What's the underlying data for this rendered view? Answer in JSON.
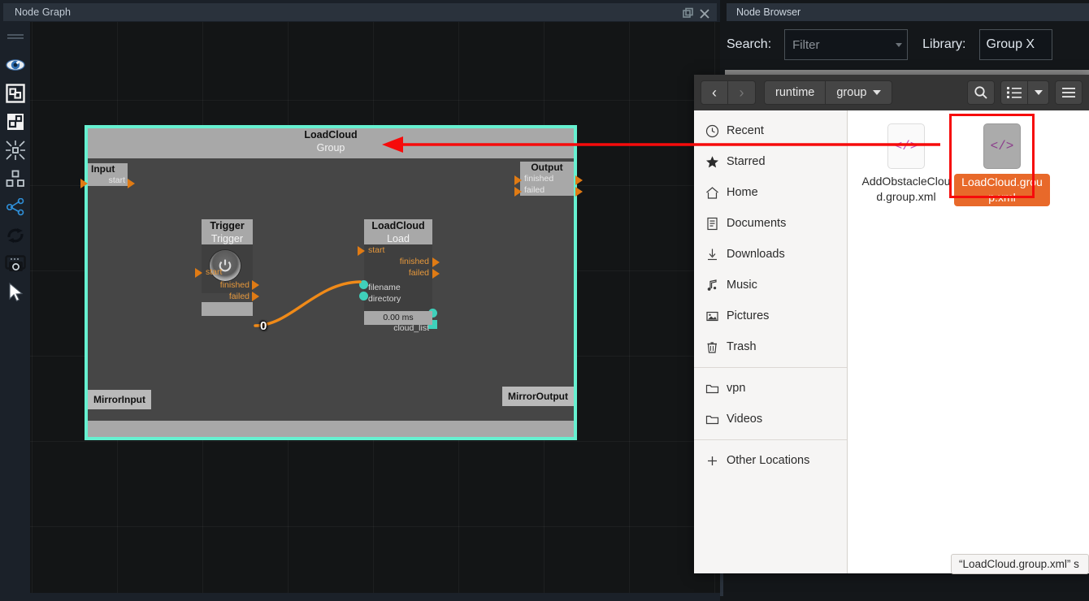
{
  "node_graph": {
    "title": "Node Graph",
    "window_buttons": [
      {
        "name": "restore-icon",
        "label": "❐"
      },
      {
        "name": "close-icon",
        "label": "✕"
      }
    ],
    "toolbar": [
      {
        "name": "grip-handle",
        "label": ""
      },
      {
        "name": "eye-icon",
        "label": ""
      },
      {
        "name": "group-icon",
        "label": ""
      },
      {
        "name": "ungroup-icon",
        "label": ""
      },
      {
        "name": "collapse-icon",
        "label": ""
      },
      {
        "name": "layout-icon",
        "label": ""
      },
      {
        "name": "share-nodes-icon",
        "label": ""
      },
      {
        "name": "refresh-icon",
        "label": ""
      },
      {
        "name": "screenshot-icon",
        "label": ""
      },
      {
        "name": "cursor-icon",
        "label": ""
      }
    ],
    "group": {
      "name": "LoadCloud",
      "type": "Group",
      "input_node": {
        "title": "Input",
        "ports": [
          "start"
        ]
      },
      "output_node": {
        "title": "Output",
        "ports": [
          "finished",
          "failed"
        ]
      },
      "mirror_input": "MirrorInput",
      "mirror_output": "MirrorOutput",
      "nodes": [
        {
          "name": "Trigger",
          "type": "Trigger",
          "inputs": [
            "start"
          ],
          "outputs": [
            "finished",
            "failed"
          ],
          "badge": "0",
          "has_power_button": true
        },
        {
          "name": "LoadCloud",
          "type": "Load",
          "inputs": [
            "start"
          ],
          "outputs": [
            "finished",
            "failed"
          ],
          "data_inputs": [
            "filename",
            "directory"
          ],
          "data_outputs": [
            "cloud",
            "cloud_list"
          ],
          "time": "0.00 ms"
        }
      ]
    },
    "colors": {
      "group_border": "#66f0d0",
      "exec_port": "#e6983c",
      "data_port": "#3fd0bb",
      "link": "#f08a18",
      "annotation": "#f60b0b"
    }
  },
  "node_browser": {
    "title": "Node Browser",
    "search_label": "Search:",
    "search_placeholder": "Filter",
    "search_value": "",
    "library_label": "Library:",
    "library_value": "Group X"
  },
  "file_dialog": {
    "nav": {
      "back_label": "‹",
      "forward_label": "›"
    },
    "breadcrumbs": [
      "runtime",
      "group"
    ],
    "actions": [
      {
        "name": "search-icon",
        "label": ""
      },
      {
        "name": "list-view-icon",
        "label": ""
      },
      {
        "name": "view-options-chevron-icon",
        "label": ""
      },
      {
        "name": "hamburger-menu-icon",
        "label": ""
      }
    ],
    "places": [
      {
        "label": "Recent",
        "icon": "clock-icon"
      },
      {
        "label": "Starred",
        "icon": "star-icon"
      },
      {
        "label": "Home",
        "icon": "home-icon"
      },
      {
        "label": "Documents",
        "icon": "document-icon"
      },
      {
        "label": "Downloads",
        "icon": "download-icon"
      },
      {
        "label": "Music",
        "icon": "music-note-icon"
      },
      {
        "label": "Pictures",
        "icon": "picture-icon"
      },
      {
        "label": "Trash",
        "icon": "trash-icon"
      }
    ],
    "bookmarks": [
      {
        "label": "vpn",
        "icon": "folder-icon"
      },
      {
        "label": "Videos",
        "icon": "folder-icon"
      }
    ],
    "other_locations": {
      "label": "Other Locations",
      "icon": "plus-icon"
    },
    "files": [
      {
        "name": "AddObstacleCloud.group.xml",
        "icon_label": "</>",
        "selected": false
      },
      {
        "name": "LoadCloud.group.xml",
        "icon_label": "</>",
        "selected": true
      }
    ],
    "tooltip": "“LoadCloud.group.xml” s"
  }
}
